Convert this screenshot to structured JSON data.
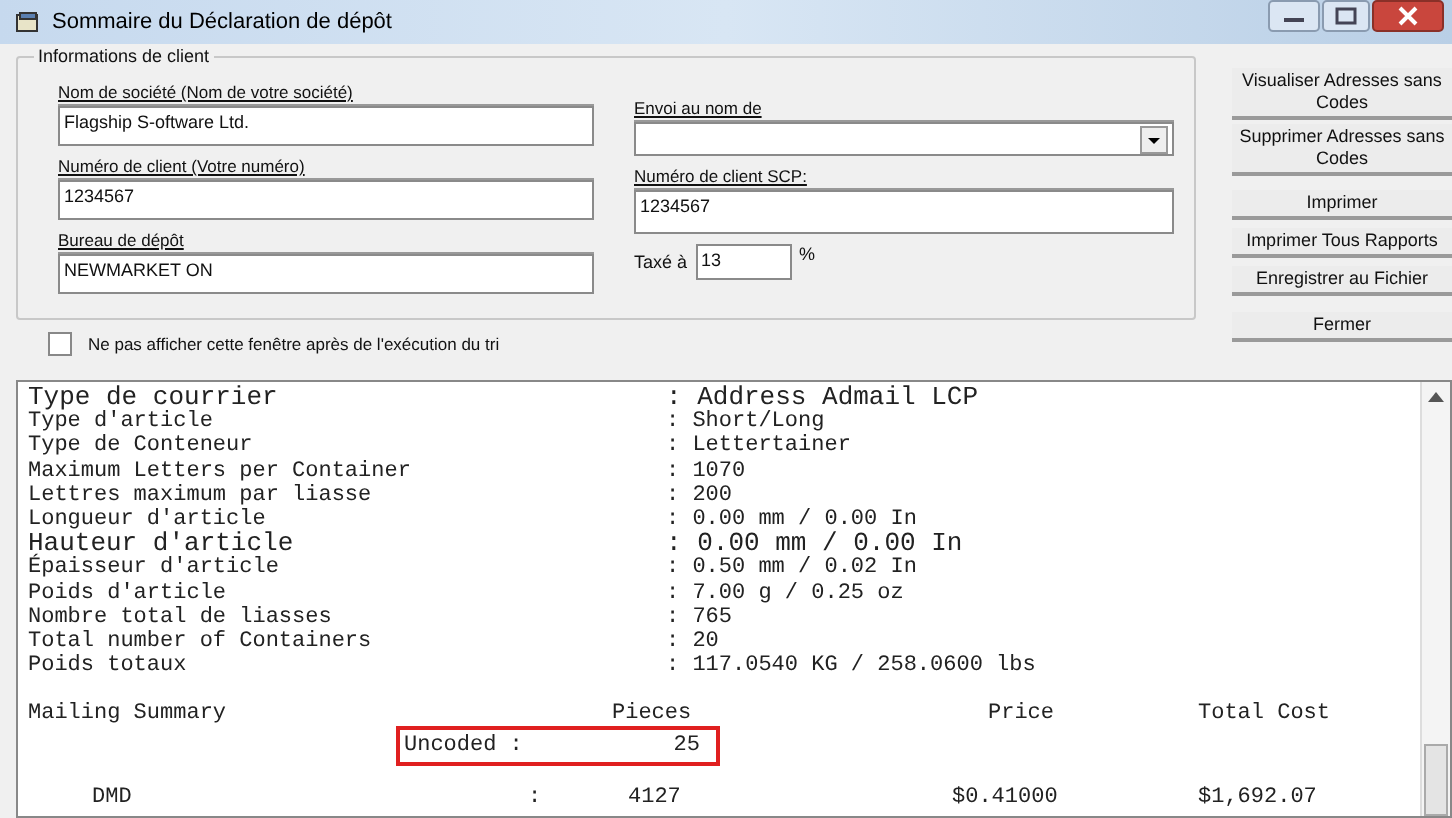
{
  "window": {
    "title": "Sommaire du Déclaration de dépôt"
  },
  "client_info": {
    "title": "Informations de client",
    "left_fields": [
      {
        "label": "Nom de société (Nom de votre société)",
        "value": "Flagship S-oftware Ltd."
      },
      {
        "label": "Numéro de client (Votre numéro)",
        "value": "1234567"
      },
      {
        "label": "Bureau de dépôt",
        "value": "NEWMARKET ON"
      }
    ],
    "envoi": {
      "label": "Envoi au nom de"
    },
    "scp": {
      "label": "Numéro de client SCP:",
      "value": "1234567"
    },
    "tax": {
      "label": "Taxé à",
      "value": "13",
      "unit": "%"
    }
  },
  "checkbox": {
    "label": "Ne pas afficher cette fenêtre après de l'exécution du tri",
    "checked": false
  },
  "buttons": [
    "Visualiser Adresses sans Codes",
    "Supprimer Adresses sans Codes",
    "Imprimer",
    "Imprimer Tous Rapports",
    "Enregistrer au Fichier",
    "Fermer"
  ],
  "report": {
    "rows": [
      {
        "label": "Type de courrier",
        "value": ": Address Admail LCP"
      },
      {
        "label": "Type d'article",
        "value": ": Short/Long"
      },
      {
        "label": "Type de Conteneur",
        "value": ": Lettertainer"
      },
      {
        "label": "Maximum Letters per Container",
        "value": ": 1070"
      },
      {
        "label": "Lettres maximum par liasse",
        "value": ": 200"
      },
      {
        "label": "Longueur d'article",
        "value": ": 0.00 mm / 0.00 In"
      },
      {
        "label": "Hauteur d'article",
        "value": ": 0.00 mm / 0.00 In"
      },
      {
        "label": "Épaisseur d'article",
        "value": ": 0.50 mm / 0.02 In"
      },
      {
        "label": "Poids d'article",
        "value": ": 7.00 g / 0.25 oz"
      },
      {
        "label": "Nombre total de liasses",
        "value": ": 765"
      },
      {
        "label": "Total number of Containers",
        "value": ": 20"
      },
      {
        "label": "Poids totaux",
        "value": ": 117.0540 KG / 258.0600 lbs"
      }
    ],
    "summary": {
      "title": "Mailing Summary",
      "columns": [
        "Pieces",
        "Price",
        "Total Cost"
      ],
      "uncoded": {
        "label": "Uncoded :",
        "pieces": "25"
      },
      "rows": [
        {
          "name": "DMD",
          "separator": ":",
          "pieces": "4127",
          "price": "$0.41000",
          "total": "$1,692.07"
        }
      ]
    }
  }
}
